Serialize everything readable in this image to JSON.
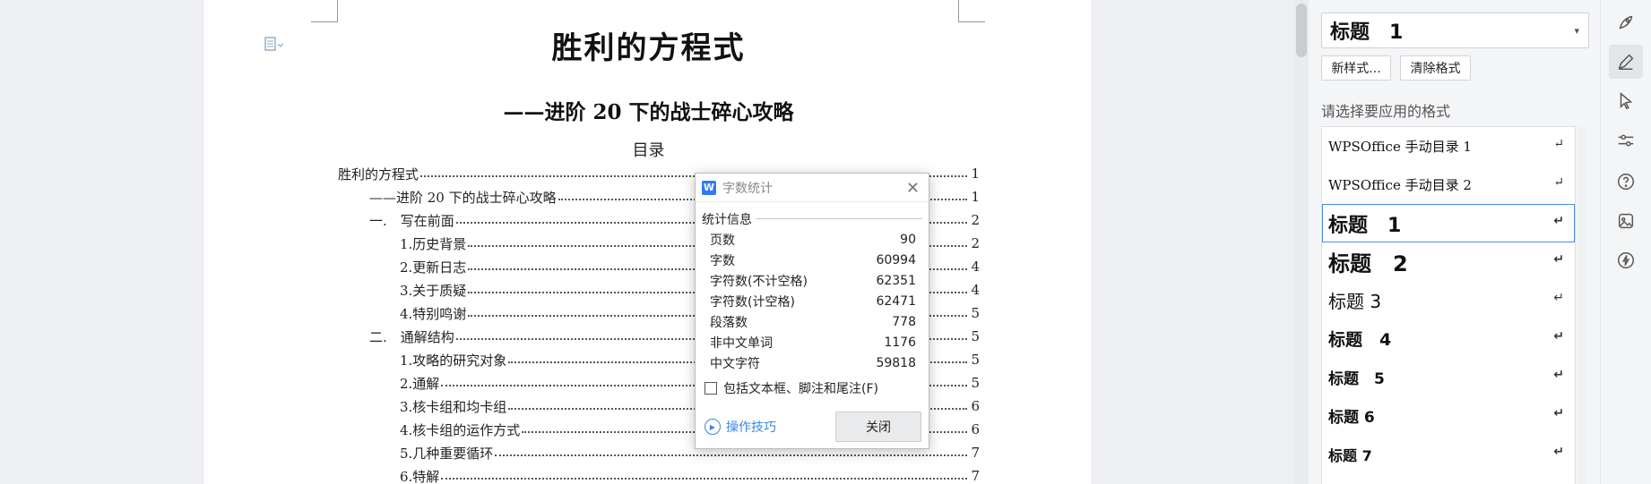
{
  "document": {
    "title": "胜利的方程式",
    "subtitle": "——进阶 20 下的战士碎心攻略",
    "toc_heading": "目录",
    "toc": [
      {
        "text": "胜利的方程式",
        "page": "1",
        "level": 1
      },
      {
        "text": "——进阶 20 下的战士碎心攻略",
        "page": "1",
        "level": 2
      },
      {
        "text": "一.　写在前面",
        "page": "2",
        "level": 3
      },
      {
        "text": "1.历史背景",
        "page": "2",
        "level": 4
      },
      {
        "text": "2.更新日志",
        "page": "4",
        "level": 4
      },
      {
        "text": "3.关于质疑",
        "page": "4",
        "level": 4
      },
      {
        "text": "4.特别鸣谢",
        "page": "5",
        "level": 4
      },
      {
        "text": "二.　通解结构",
        "page": "5",
        "level": 3
      },
      {
        "text": "1.攻略的研究对象",
        "page": "5",
        "level": 4
      },
      {
        "text": "2.通解",
        "page": "5",
        "level": 4
      },
      {
        "text": "3.核卡组和均卡组",
        "page": "6",
        "level": 4
      },
      {
        "text": "4.核卡组的运作方式",
        "page": "6",
        "level": 4
      },
      {
        "text": "5.几种重要循环",
        "page": "7",
        "level": 4
      },
      {
        "text": "6.特解",
        "page": "7",
        "level": 4
      }
    ]
  },
  "dialog": {
    "title": "字数统计",
    "group_label": "统计信息",
    "stats": [
      {
        "label": "页数",
        "value": "90"
      },
      {
        "label": "字数",
        "value": "60994"
      },
      {
        "label": "字符数(不计空格)",
        "value": "62351"
      },
      {
        "label": "字符数(计空格)",
        "value": "62471"
      },
      {
        "label": "段落数",
        "value": "778"
      },
      {
        "label": "非中文单词",
        "value": "1176"
      },
      {
        "label": "中文字符",
        "value": "59818"
      }
    ],
    "checkbox_label": "包括文本框、脚注和尾注(F)",
    "checkbox_checked": false,
    "tips_label": "操作技巧",
    "close_label": "关闭",
    "logo": "W"
  },
  "pane": {
    "current_style": "标题　1",
    "new_style_label": "新样式...",
    "clear_format_label": "清除格式",
    "hint": "请选择要应用的格式",
    "styles": [
      {
        "label": "WPSOffice 手动目录 1",
        "cls": "s-toc"
      },
      {
        "label": "WPSOffice 手动目录 2",
        "cls": "s-toc"
      },
      {
        "label": "标题　1",
        "cls": "s-h1",
        "selected": true
      },
      {
        "label": "标题　2",
        "cls": "s-h2"
      },
      {
        "label": "标题 3",
        "cls": "s-h3"
      },
      {
        "label": "标题　4",
        "cls": "s-h4"
      },
      {
        "label": "标题　5",
        "cls": "s-h5"
      },
      {
        "label": "标题 6",
        "cls": "s-h6"
      },
      {
        "label": "标题 7",
        "cls": "s-h7"
      }
    ],
    "return_glyph": "↵"
  },
  "toolbar": {
    "icons": [
      "rocket-icon",
      "pen-icon",
      "cursor-icon",
      "sliders-icon",
      "help-icon",
      "image-icon",
      "lightning-icon"
    ],
    "active": "pen-icon"
  }
}
